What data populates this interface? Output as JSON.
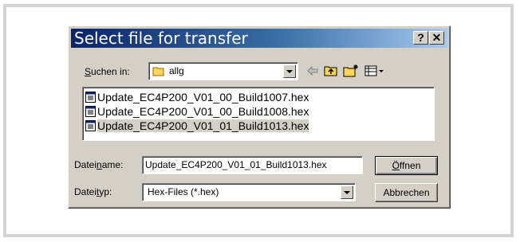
{
  "dialog": {
    "title": "Select file for transfer",
    "help_button": "?",
    "close_button": "✕"
  },
  "look_in": {
    "label_pre": "",
    "label_accel": "S",
    "label_post": "uchen in:",
    "value": "allg"
  },
  "files": [
    {
      "name": "Update_EC4P200_V01_00_Build1007.hex",
      "selected": false
    },
    {
      "name": "Update_EC4P200_V01_00_Build1008.hex",
      "selected": false
    },
    {
      "name": "Update_EC4P200_V01_01_Build1013.hex",
      "selected": true
    }
  ],
  "filename": {
    "label_pre": "Datei",
    "label_accel": "n",
    "label_post": "ame:",
    "value": "Update_EC4P200_V01_01_Build1013.hex"
  },
  "filetype": {
    "label_pre": "Datei",
    "label_accel": "t",
    "label_post": "yp:",
    "value": "Hex-Files (*.hex)"
  },
  "buttons": {
    "open_accel": "Ö",
    "open_rest": "ffnen",
    "cancel": "Abbrechen"
  },
  "colors": {
    "titlebar_start": "#0a246a",
    "titlebar_end": "#a6caf0",
    "dialog_face": "#d4d0c8",
    "folder": "#ffd65a"
  },
  "icons": [
    "folder-icon",
    "back-arrow-icon",
    "up-folder-icon",
    "new-folder-icon",
    "view-menu-icon",
    "hex-file-icon"
  ]
}
